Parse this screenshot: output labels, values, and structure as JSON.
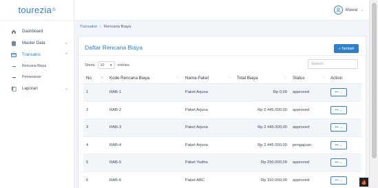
{
  "brand": {
    "name": "tourezia",
    "mark": "®"
  },
  "sidebar": {
    "items": [
      {
        "label": "Dashboard",
        "icon": "home-icon"
      },
      {
        "label": "Master Data",
        "icon": "database-icon"
      },
      {
        "label": "Transaksi",
        "icon": "card-icon"
      },
      {
        "label": "Laporan",
        "icon": "copy-icon"
      }
    ],
    "subitems": [
      {
        "label": "Rencana Biaya"
      },
      {
        "label": "Pemesanan"
      }
    ]
  },
  "topbar": {
    "user_name": "Mawar"
  },
  "breadcrumb": {
    "parent": "Transaksi",
    "separator": "›",
    "current": "Rencana Biaya"
  },
  "card": {
    "title": "Daftar Rencana Biaya",
    "add_button": "+ Tambah",
    "show_label": "Show",
    "entries_value": "10",
    "entries_label": "entries",
    "search_placeholder": "Search"
  },
  "table": {
    "headers": [
      "No",
      "Kode Rencana Biaya",
      "Nama Paket",
      "Total Biaya",
      "Status",
      "Action"
    ],
    "rows": [
      {
        "no": "1",
        "kode": "RAB-1",
        "paket": "Paket Arjuna",
        "total": "Rp 0,00",
        "status": "approved"
      },
      {
        "no": "2",
        "kode": "RAB-2",
        "paket": "Paket Arjuna",
        "total": "Rp 2.445.000,00",
        "status": "approved"
      },
      {
        "no": "3",
        "kode": "RAB-3",
        "paket": "Paket Arjuna",
        "total": "Rp 2.445.000,00",
        "status": "approved"
      },
      {
        "no": "4",
        "kode": "RAB-4",
        "paket": "Paket Arjuna",
        "total": "Rp 2.445.000,00",
        "status": "pengajuan"
      },
      {
        "no": "5",
        "kode": "RAB-5",
        "paket": "Paket Yudha",
        "total": "Rp 250.000,00",
        "status": "approved"
      },
      {
        "no": "6",
        "kode": "RAB-6",
        "paket": "Paket ABC",
        "total": "Rp 310.000,00",
        "status": "approved"
      }
    ],
    "action_label": "•••"
  },
  "colors": {
    "accent": "#2f80c7",
    "row_stripe": "#f2f6fb"
  }
}
